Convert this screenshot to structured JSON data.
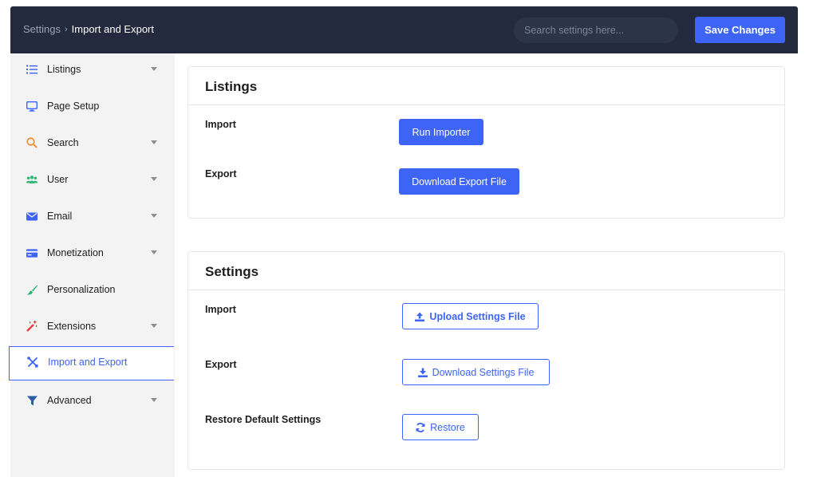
{
  "header": {
    "breadcrumb_root": "Settings",
    "breadcrumb_separator": "›",
    "breadcrumb_current": "Import and Export",
    "search_placeholder": "Search settings here...",
    "save_label": "Save Changes"
  },
  "sidebar": {
    "items": [
      {
        "label": "Listings",
        "icon": "list-icon",
        "has_submenu": true
      },
      {
        "label": "Page Setup",
        "icon": "monitor-icon",
        "has_submenu": false
      },
      {
        "label": "Search",
        "icon": "search-icon",
        "has_submenu": true
      },
      {
        "label": "User",
        "icon": "users-icon",
        "has_submenu": true
      },
      {
        "label": "Email",
        "icon": "envelope-icon",
        "has_submenu": true
      },
      {
        "label": "Monetization",
        "icon": "credit-card-icon",
        "has_submenu": true
      },
      {
        "label": "Personalization",
        "icon": "paintbrush-icon",
        "has_submenu": false
      },
      {
        "label": "Extensions",
        "icon": "magic-wand-icon",
        "has_submenu": true
      },
      {
        "label": "Import and Export",
        "icon": "tools-icon",
        "has_submenu": false,
        "active": true
      },
      {
        "label": "Advanced",
        "icon": "filter-icon",
        "has_submenu": true
      }
    ]
  },
  "listings_panel": {
    "title": "Listings",
    "import_label": "Import",
    "import_button": "Run Importer",
    "export_label": "Export",
    "export_button": "Download Export File"
  },
  "settings_panel": {
    "title": "Settings",
    "import_label": "Import",
    "import_button": "Upload Settings File",
    "export_label": "Export",
    "export_button": "Download Settings File",
    "restore_label": "Restore Default Settings",
    "restore_button": "Restore"
  },
  "colors": {
    "accent": "#3e64f5",
    "header_bg": "#232a3d",
    "sidebar_bg": "#f3f3f4"
  }
}
